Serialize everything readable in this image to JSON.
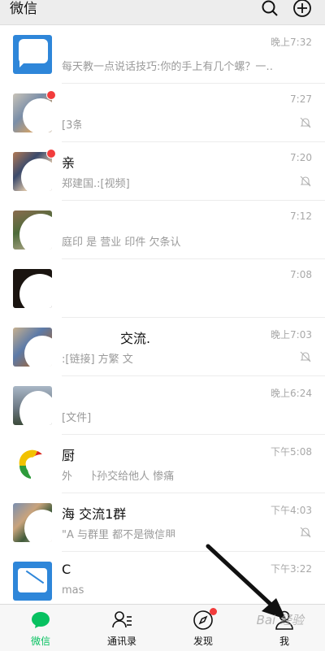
{
  "header": {
    "title": "微信",
    "search_icon": "search-icon",
    "add_icon": "plus-circle-icon"
  },
  "chats": [
    {
      "name": "",
      "preview": "每天教一点说话技巧:你的手上有几个螺？一…",
      "time": "晚上7:32",
      "muted": false,
      "unread": false
    },
    {
      "name": "",
      "preview": "[3条]                免费，有人…",
      "time": "7:27",
      "muted": true,
      "unread": true
    },
    {
      "name": "亲",
      "preview": "郑建国.:[视频]",
      "time": "7:20",
      "muted": true,
      "unread": true
    },
    {
      "name": "",
      "preview": "          庭印      是  营业    印件 欠条认",
      "time": "7:12",
      "muted": false,
      "unread": false
    },
    {
      "name": "",
      "preview": "",
      "time": "7:08",
      "muted": false,
      "unread": false
    },
    {
      "name": "交流.",
      "preview": "        :[链接]         方繁           文",
      "time": "晚上7:03",
      "muted": true,
      "unread": false
    },
    {
      "name": "",
      "preview": "[文件]",
      "time": "晚上6:24",
      "muted": false,
      "unread": false
    },
    {
      "name": "厨",
      "preview": "外       把外孙交给他人        惨痛",
      "time": "下午5:08",
      "muted": false,
      "unread": false
    },
    {
      "name": "海         交流1群",
      "preview": "\"A            与群里    都不是微信朋",
      "time": "下午4:03",
      "muted": true,
      "unread": false
    },
    {
      "name": "C",
      "preview": "mas",
      "time": "下午3:22",
      "muted": false,
      "unread": false
    }
  ],
  "tabs": [
    {
      "label": "微信",
      "icon": "chat-bubble-icon",
      "active": true,
      "badge": false
    },
    {
      "label": "通讯录",
      "icon": "contacts-icon",
      "active": false,
      "badge": false
    },
    {
      "label": "发现",
      "icon": "compass-icon",
      "active": false,
      "badge": true
    },
    {
      "label": "我",
      "icon": "person-icon",
      "active": false,
      "badge": false
    }
  ],
  "watermark": "Bai 经验",
  "colors": {
    "accent": "#07c160",
    "badge": "#f23c3c",
    "header_bg": "#ededed",
    "tabbar_bg": "#f7f7f7"
  }
}
